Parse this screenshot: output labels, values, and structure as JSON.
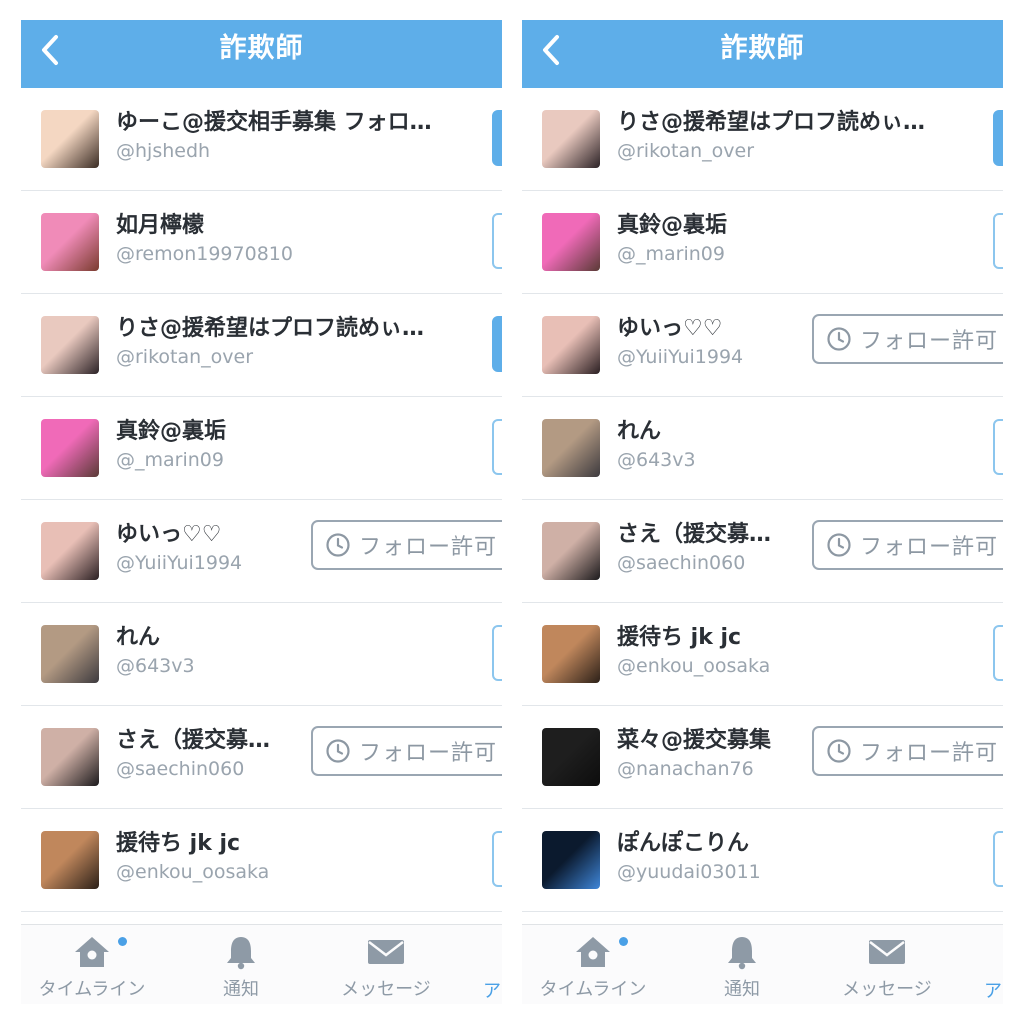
{
  "screens": [
    {
      "header": {
        "title": "詐欺師"
      },
      "rows": [
        {
          "name": "ゆーこ@援交相手募集 フォロ…",
          "handle": "@hjshedh",
          "button": "edge-filled",
          "avatar": [
            "#f4d7c2",
            "#3a2c24"
          ]
        },
        {
          "name": "如月檸檬",
          "handle": "@remon19970810",
          "button": "edge",
          "avatar": [
            "#f08bb8",
            "#7a3b2e"
          ]
        },
        {
          "name": "りさ@援希望はプロフ読めぃ…",
          "handle": "@rikotan_over",
          "button": "edge-filled",
          "avatar": [
            "#e9c9bf",
            "#2b2226"
          ]
        },
        {
          "name": "真鈴@裏垢",
          "handle": "@_marin09",
          "button": "edge",
          "avatar": [
            "#f06ab8",
            "#5a3a36"
          ]
        },
        {
          "name": "ゆいっ♡♡",
          "handle": "@YuiiYui1994",
          "button": "request",
          "avatar": [
            "#e8bfb6",
            "#2a1f22"
          ]
        },
        {
          "name": "れん",
          "handle": "@643v3",
          "button": "edge",
          "avatar": [
            "#b39a83",
            "#3d3a3e"
          ]
        },
        {
          "name": "さえ（援交募…",
          "handle": "@saechin060",
          "button": "request",
          "avatar": [
            "#cfb0a6",
            "#1c1a1c"
          ]
        },
        {
          "name": "援待ち jk jc",
          "handle": "@enkou_oosaka",
          "button": "edge",
          "avatar": [
            "#c0875c",
            "#2c2018"
          ]
        }
      ],
      "tabbar": {
        "timeline": "タイムライン",
        "notify": "通知",
        "message": "メッセージ",
        "cut": "ア"
      }
    },
    {
      "header": {
        "title": "詐欺師"
      },
      "rows": [
        {
          "name": "りさ@援希望はプロフ読めぃ…",
          "handle": "@rikotan_over",
          "button": "edge-filled",
          "avatar": [
            "#e9c9bf",
            "#2b2226"
          ]
        },
        {
          "name": "真鈴@裏垢",
          "handle": "@_marin09",
          "button": "edge",
          "avatar": [
            "#f06ab8",
            "#5a3a36"
          ]
        },
        {
          "name": "ゆいっ♡♡",
          "handle": "@YuiiYui1994",
          "button": "request",
          "avatar": [
            "#e8bfb6",
            "#2a1f22"
          ]
        },
        {
          "name": "れん",
          "handle": "@643v3",
          "button": "edge",
          "avatar": [
            "#b39a83",
            "#3d3a3e"
          ]
        },
        {
          "name": "さえ（援交募…",
          "handle": "@saechin060",
          "button": "request",
          "avatar": [
            "#cfb0a6",
            "#1c1a1c"
          ]
        },
        {
          "name": "援待ち jk jc",
          "handle": "@enkou_oosaka",
          "button": "edge",
          "avatar": [
            "#c0875c",
            "#2c2018"
          ]
        },
        {
          "name": "菜々@援交募集",
          "handle": "@nanachan76",
          "button": "request",
          "avatar": [
            "#1e1e1e",
            "#0d0d0d"
          ]
        },
        {
          "name": "ぽんぽこりん",
          "handle": "@yuudai03011",
          "button": "edge",
          "avatar": [
            "#0b1a2e",
            "#3f86d8"
          ]
        }
      ],
      "tabbar": {
        "timeline": "タイムライン",
        "notify": "通知",
        "message": "メッセージ",
        "cut": "ア"
      }
    }
  ],
  "labels": {
    "follow_request": "フォロー許可"
  },
  "colors": {
    "header": "#5eaee9",
    "accent": "#4aa0e6",
    "text": "#2a2f35",
    "muted": "#9aa4ae"
  }
}
